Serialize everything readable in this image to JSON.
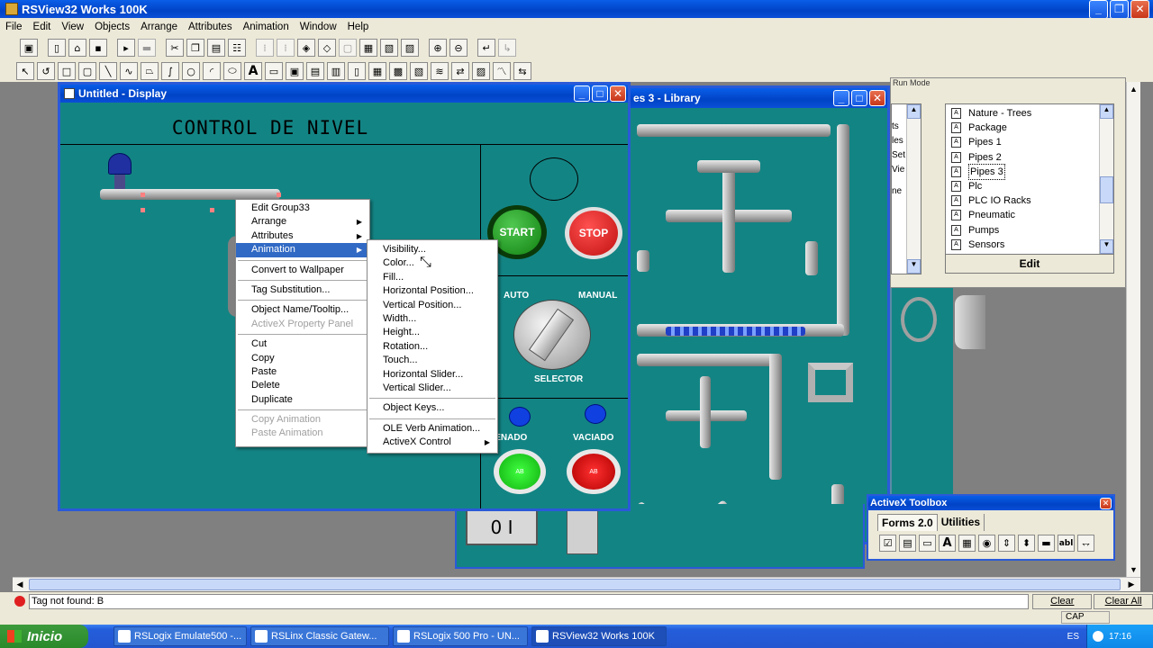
{
  "app": {
    "title": "RSView32 Works 100K",
    "menu": [
      "File",
      "Edit",
      "View",
      "Objects",
      "Arrange",
      "Attributes",
      "Animation",
      "Window",
      "Help"
    ]
  },
  "toolbar1": [
    "save-icon",
    "new-icon",
    "open-icon",
    "disk-icon",
    "run-icon",
    "stop-icon",
    "cut-icon",
    "copy-icon",
    "paste-icon",
    "grid-icon",
    "group-icon",
    "ungroup-icon",
    "front-icon",
    "back-icon",
    "align-icon",
    "zoom-in-icon",
    "zoom-out-icon",
    "undo-icon",
    "redo-icon"
  ],
  "toolbar2": [
    "pointer-icon",
    "rotate-icon",
    "rectangle-icon",
    "rounded-rect-icon",
    "line-icon",
    "polyline-icon",
    "polygon-icon",
    "freehand-icon",
    "ellipse-icon",
    "arc-icon",
    "text-icon",
    "display-icon",
    "button-icon",
    "numeric-input-icon",
    "string-input-icon",
    "symbol-icon",
    "alarm-icon",
    "trend-icon",
    "summary-icon",
    "wave-icon",
    "arrow-icon"
  ],
  "display": {
    "title": "Untitled - Display",
    "heading": "CONTROL DE NIVEL",
    "buttons": {
      "start": "START",
      "stop": "STOP",
      "auto": "AUTO",
      "manual": "MANUAL",
      "selector": "SELECTOR",
      "llenado": "LLENADO",
      "vaciado": "VACIADO",
      "ab1": "AB",
      "ab2": "AB"
    }
  },
  "library": {
    "title": "es 3 - Library",
    "partial_items": [
      "ts",
      "les",
      "Set",
      "Vie",
      "ne"
    ],
    "run_mode_text": "Run Mode",
    "items": [
      "Nature - Trees",
      "Package",
      "Pipes 1",
      "Pipes 2",
      "Pipes 3",
      "Plc",
      "PLC IO Racks",
      "Pneumatic",
      "Pumps",
      "Sensors"
    ],
    "selected": "Pipes 3",
    "edit_button": "Edit"
  },
  "context_menu": {
    "items": [
      {
        "label": "Edit Group33",
        "type": "item"
      },
      {
        "label": "Arrange",
        "type": "submenu"
      },
      {
        "label": "Attributes",
        "type": "submenu"
      },
      {
        "label": "Animation",
        "type": "submenu-active"
      },
      {
        "type": "sep"
      },
      {
        "label": "Convert to Wallpaper",
        "type": "item"
      },
      {
        "type": "sep"
      },
      {
        "label": "Tag Substitution...",
        "type": "item"
      },
      {
        "type": "sep"
      },
      {
        "label": "Object Name/Tooltip...",
        "type": "item"
      },
      {
        "label": "ActiveX Property Panel",
        "type": "disabled"
      },
      {
        "type": "sep"
      },
      {
        "label": "Cut",
        "type": "item"
      },
      {
        "label": "Copy",
        "type": "item"
      },
      {
        "label": "Paste",
        "type": "item"
      },
      {
        "label": "Delete",
        "type": "item"
      },
      {
        "label": "Duplicate",
        "type": "item"
      },
      {
        "type": "sep"
      },
      {
        "label": "Copy Animation",
        "type": "disabled"
      },
      {
        "label": "Paste Animation",
        "type": "disabled"
      }
    ]
  },
  "animation_menu": {
    "items": [
      {
        "label": "Visibility...",
        "type": "item"
      },
      {
        "label": "Color...",
        "type": "item"
      },
      {
        "label": "Fill...",
        "type": "item"
      },
      {
        "label": "Horizontal Position...",
        "type": "item"
      },
      {
        "label": "Vertical Position...",
        "type": "item"
      },
      {
        "label": "Width...",
        "type": "item"
      },
      {
        "label": "Height...",
        "type": "item"
      },
      {
        "label": "Rotation...",
        "type": "item"
      },
      {
        "label": "Touch...",
        "type": "item"
      },
      {
        "label": "Horizontal Slider...",
        "type": "item"
      },
      {
        "label": "Vertical Slider...",
        "type": "item"
      },
      {
        "type": "sep"
      },
      {
        "label": "Object Keys...",
        "type": "item"
      },
      {
        "type": "sep"
      },
      {
        "label": "OLE Verb Animation...",
        "type": "item"
      },
      {
        "label": "ActiveX Control",
        "type": "submenu"
      }
    ]
  },
  "activex_toolbox": {
    "title": "ActiveX Toolbox",
    "tabs": [
      "Forms 2.0",
      "Utilities"
    ],
    "tools": [
      "checkbox-icon",
      "listbox-icon",
      "textbox-icon",
      "label-icon",
      "frame-icon",
      "option-icon",
      "spin-icon",
      "scroll-icon",
      "toggle-icon",
      "textfield-icon",
      "combo-icon"
    ]
  },
  "status": {
    "message": "Tag not found: B",
    "clear": "Clear",
    "clear_all": "Clear All",
    "cap": "CAP"
  },
  "taskbar": {
    "start": "Inicio",
    "tasks": [
      "RSLogix Emulate500 -...",
      "RSLinx Classic Gatew...",
      "RSLogix 500 Pro - UN...",
      "RSView32 Works 100K"
    ],
    "active_index": 3,
    "lang": "ES",
    "time": "17:16"
  }
}
